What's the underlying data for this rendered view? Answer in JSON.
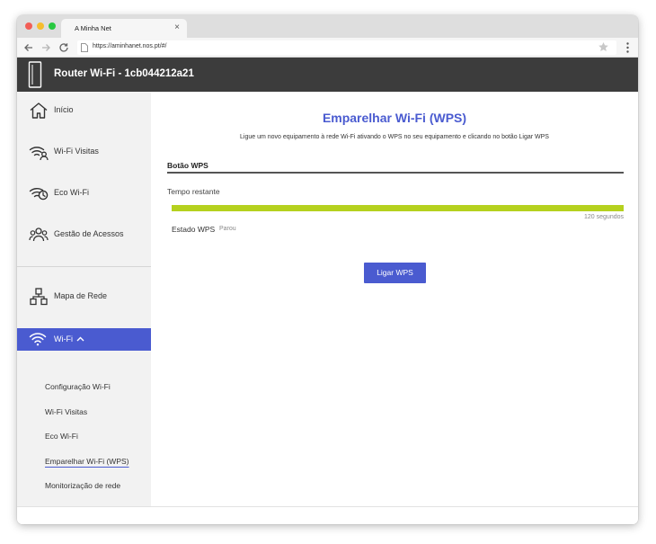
{
  "browser": {
    "tab_title": "A Minha Net",
    "tab_close": "×",
    "url": "https://aminhanet.nos.pt/#/"
  },
  "header": {
    "title": "Router Wi-Fi - 1cb044212a21",
    "background_color": "#3c3c3c"
  },
  "sidebar": {
    "items": [
      {
        "label": "Início",
        "icon": "home-icon"
      },
      {
        "label": "Wi-Fi Visitas",
        "icon": "guest-wifi-icon"
      },
      {
        "label": "Eco Wi-Fi",
        "icon": "eco-wifi-icon"
      },
      {
        "label": "Gestão de Acessos",
        "icon": "users-icon"
      },
      {
        "label": "Mapa de Rede",
        "icon": "network-map-icon"
      }
    ],
    "active": {
      "label": "Wi-Fi",
      "icon": "wifi-icon",
      "chevron": "chevron-up-icon"
    },
    "subitems": [
      {
        "label": "Configuração Wi-Fi"
      },
      {
        "label": "Wi-Fi Visitas"
      },
      {
        "label": "Eco Wi-Fi"
      },
      {
        "label": "Emparelhar Wi-Fi (WPS)"
      },
      {
        "label": "Monitorização de rede"
      }
    ]
  },
  "main": {
    "title": "Emparelhar Wi-Fi (WPS)",
    "subtitle": "Ligue um novo equipamento à rede Wi-Fi ativando o WPS no seu equipamento e clicando no botão Ligar WPS",
    "section_title": "Botão WPS",
    "remaining_label": "Tempo restante",
    "progress": {
      "percent": 100,
      "color": "#b5d11e"
    },
    "seconds": "120 segundos",
    "state_label": "Estado WPS",
    "state_value": "Parou",
    "button_label": "Ligar WPS"
  },
  "colors": {
    "accent": "#4a5bd0",
    "sidebar_bg": "#f2f2f2"
  }
}
